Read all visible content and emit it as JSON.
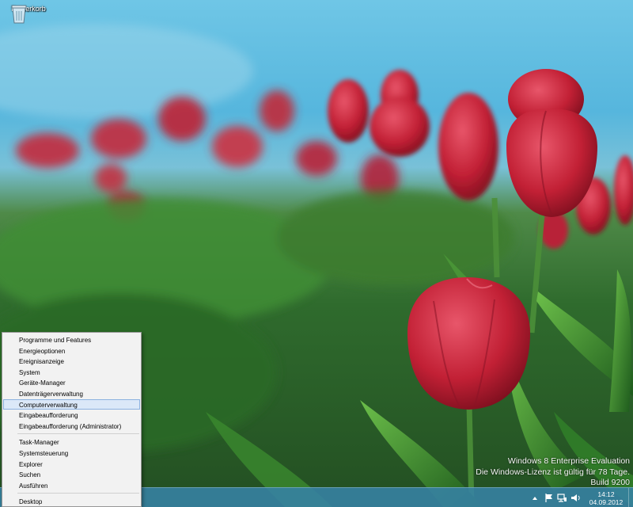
{
  "desktop": {
    "icons": [
      {
        "label": "Papierkorb",
        "icon": "recycle-bin-icon"
      }
    ],
    "watermark": {
      "edition": "Windows 8 Enterprise Evaluation",
      "license": "Die Windows-Lizenz ist gültig für 78 Tage.",
      "build": "Build 9200"
    }
  },
  "context_menu": {
    "groups": [
      [
        {
          "label": "Programme und Features"
        },
        {
          "label": "Energieoptionen"
        },
        {
          "label": "Ereignisanzeige"
        },
        {
          "label": "System"
        },
        {
          "label": "Geräte-Manager"
        },
        {
          "label": "Datenträgerverwaltung"
        },
        {
          "label": "Computerverwaltung",
          "highlighted": true
        },
        {
          "label": "Eingabeaufforderung"
        },
        {
          "label": "Eingabeaufforderung (Administrator)"
        }
      ],
      [
        {
          "label": "Task-Manager"
        },
        {
          "label": "Systemsteuerung"
        },
        {
          "label": "Explorer"
        },
        {
          "label": "Suchen"
        },
        {
          "label": "Ausführen"
        }
      ],
      [
        {
          "label": "Desktop"
        }
      ]
    ]
  },
  "taskbar": {
    "tray_icons": [
      "chevron-up-icon",
      "flag-icon",
      "network-icon",
      "volume-icon"
    ],
    "clock": {
      "time": "14:12",
      "date": "04.09.2012"
    }
  },
  "colors": {
    "taskbar": "#3782a5",
    "menu_background": "#f2f2f2",
    "menu_highlight": "#dbe8f8",
    "tulip_red": "#c8283c"
  }
}
